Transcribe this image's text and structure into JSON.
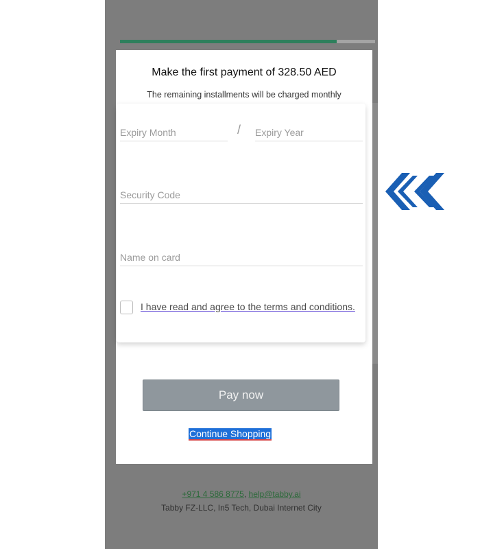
{
  "header": {
    "title": "Make the first payment of 328.50 AED",
    "subtitle": "The remaining installments will be charged monthly",
    "progress_fraction": 0.85
  },
  "form": {
    "expiry_month_placeholder": "Expiry Month",
    "expiry_separator": "/",
    "expiry_year_placeholder": "Expiry Year",
    "security_code_placeholder": "Security Code",
    "name_on_card_placeholder": "Name on card",
    "terms_label": "I have read and agree to the terms and conditions.",
    "terms_checked": false
  },
  "actions": {
    "pay_label": "Pay now",
    "continue_label": "Continue Shopping"
  },
  "footer": {
    "phone": "+971 4 586 8775",
    "separator": ", ",
    "email": "help@tabby.ai",
    "company": "Tabby FZ-LLC, In5 Tech, Dubai Internet City"
  },
  "colors": {
    "accent_green": "#2e7f5c",
    "chevron_blue": "#1a5fb4",
    "button_gray": "#8f979d",
    "link_highlight": "#1e6fd8"
  },
  "icons": {
    "side_arrow": "double-chevron-left-icon"
  }
}
